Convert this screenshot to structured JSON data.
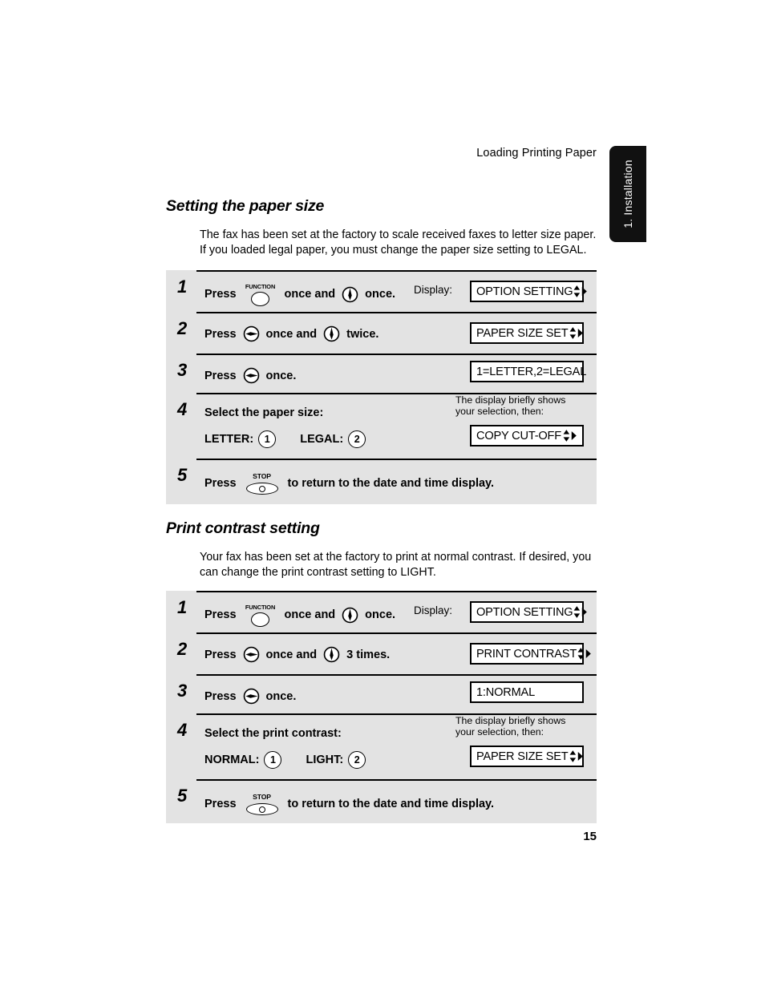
{
  "page": {
    "running_head": "Loading Printing Paper",
    "page_number": "15",
    "chapter_tab": "1. Installation"
  },
  "sections": [
    {
      "heading": "Setting the paper size",
      "intro": "The fax has been set at the factory to scale received faxes to letter size paper. If you loaded legal paper, you must change the paper size setting to LEGAL.",
      "display_label": "Display:",
      "steps": [
        {
          "num": "1",
          "text_before": "Press",
          "key1": "FUNCTION",
          "text_mid": "once and",
          "key2": "down-arrow",
          "text_after": "once.",
          "lcd": "OPTION SETTING",
          "lcd_arrows": true
        },
        {
          "num": "2",
          "text_before": "Press",
          "key1": "right-arrow",
          "text_mid": "once and",
          "key2": "down-arrow",
          "text_after": "twice.",
          "lcd": "PAPER SIZE SET",
          "lcd_arrows": true
        },
        {
          "num": "3",
          "text_before": "Press",
          "key1": "right-arrow",
          "text_after": "once.",
          "lcd": "1=LETTER,2=LEGAL",
          "lcd_arrows": false
        },
        {
          "num": "4",
          "prompt": "Select the paper size:",
          "choices": [
            {
              "label": "LETTER:",
              "key": "1"
            },
            {
              "label": "LEGAL:",
              "key": "2"
            }
          ],
          "note": "The display briefly shows\nyour selection, then:",
          "lcd": "COPY CUT-OFF",
          "lcd_arrows": true
        },
        {
          "num": "5",
          "text_before": "Press",
          "key1": "STOP",
          "text_after": "to return to the date and time display."
        }
      ]
    },
    {
      "heading": "Print contrast setting",
      "intro": "Your fax has been set at the factory to print at normal contrast. If desired, you can change the print contrast setting to LIGHT.",
      "display_label": "Display:",
      "steps": [
        {
          "num": "1",
          "text_before": "Press",
          "key1": "FUNCTION",
          "text_mid": "once and",
          "key2": "down-arrow",
          "text_after": "once.",
          "lcd": "OPTION SETTING",
          "lcd_arrows": true
        },
        {
          "num": "2",
          "text_before": "Press",
          "key1": "right-arrow",
          "text_mid": "once and",
          "key2": "down-arrow",
          "text_after": "3 times.",
          "lcd": "PRINT CONTRAST",
          "lcd_arrows": true
        },
        {
          "num": "3",
          "text_before": "Press",
          "key1": "right-arrow",
          "text_after": "once.",
          "lcd": "1:NORMAL",
          "lcd_arrows": false
        },
        {
          "num": "4",
          "prompt": "Select the print contrast:",
          "choices": [
            {
              "label": "NORMAL:",
              "key": "1"
            },
            {
              "label": "LIGHT:",
              "key": "2"
            }
          ],
          "note": "The display briefly shows\nyour selection, then:",
          "lcd": "PAPER SIZE SET",
          "lcd_arrows": true
        },
        {
          "num": "5",
          "text_before": "Press",
          "key1": "STOP",
          "text_after": "to return to the date and time display."
        }
      ]
    }
  ]
}
